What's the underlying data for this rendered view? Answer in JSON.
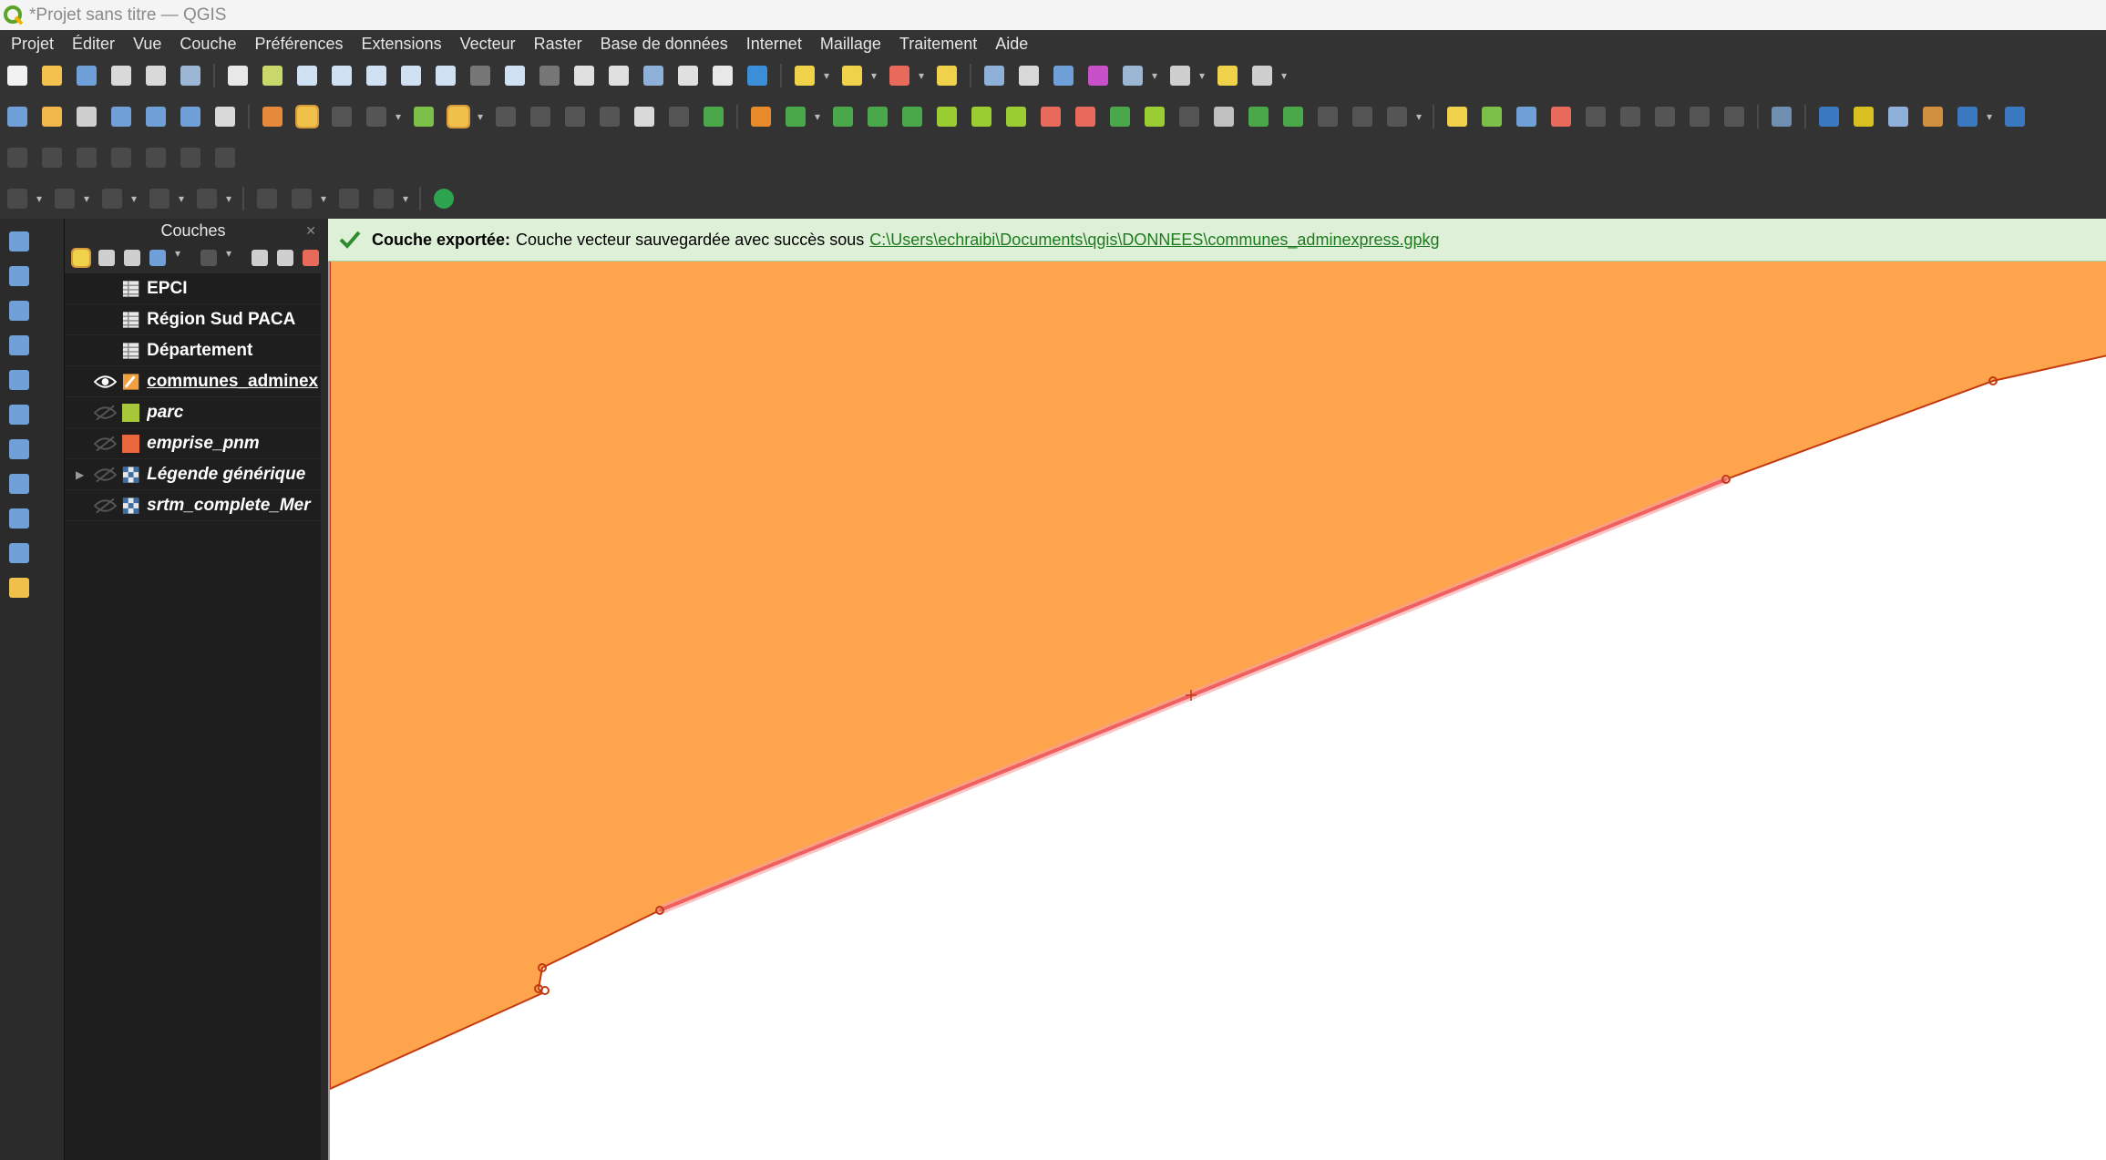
{
  "window": {
    "title": "*Projet sans titre — QGIS"
  },
  "menu": [
    "Projet",
    "Éditer",
    "Vue",
    "Couche",
    "Préférences",
    "Extensions",
    "Vecteur",
    "Raster",
    "Base de données",
    "Internet",
    "Maillage",
    "Traitement",
    "Aide"
  ],
  "layers_panel": {
    "title": "Couches",
    "items": [
      {
        "name": "EPCI",
        "style": "b",
        "visible": "none",
        "symbol": "table-icon"
      },
      {
        "name": "Région Sud PACA",
        "style": "b",
        "visible": "none",
        "symbol": "table-icon"
      },
      {
        "name": "Département",
        "style": "b",
        "visible": "none",
        "symbol": "table-icon"
      },
      {
        "name": "communes_adminex",
        "style": "b u",
        "visible": "on",
        "symbol": "edit-pencil-icon"
      },
      {
        "name": "parc",
        "style": "i",
        "visible": "off",
        "symbol": "fill-green"
      },
      {
        "name": "emprise_pnm",
        "style": "i",
        "visible": "off",
        "symbol": "fill-orange"
      },
      {
        "name": "Légende générique",
        "style": "i",
        "visible": "off",
        "symbol": "raster-icon",
        "expandable": "yes"
      },
      {
        "name": "srtm_complete_Mer",
        "style": "i",
        "visible": "off",
        "symbol": "raster-icon"
      }
    ]
  },
  "message": {
    "title": "Couche exportée:",
    "text": "Couche vecteur sauvegardée avec succès sous",
    "path": "C:\\Users\\echraibi\\Documents\\qgis\\DONNEES\\communes_adminexpress.gpkg"
  },
  "colors": {
    "polygon_fill": "#fea44c",
    "polygon_stroke": "#c23a12",
    "selected_segment": "#f06060",
    "message_bg": "#dff0d8"
  }
}
